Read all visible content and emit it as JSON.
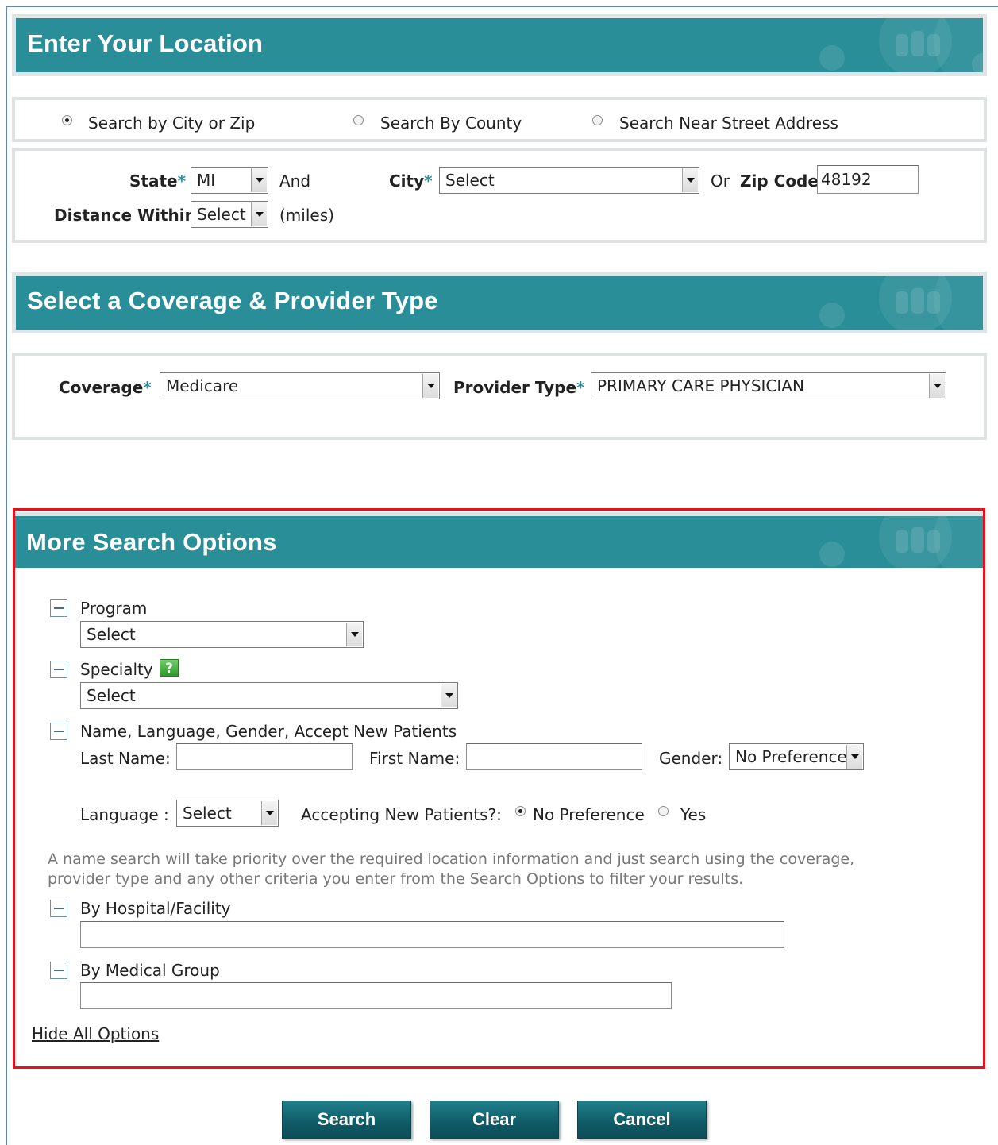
{
  "location": {
    "title": "Enter Your Location",
    "search_modes": [
      {
        "label": "Search by City or Zip",
        "selected": true
      },
      {
        "label": "Search By County",
        "selected": false
      },
      {
        "label": "Search Near Street Address",
        "selected": false
      }
    ],
    "state_label": "State",
    "state_value": "MI",
    "and_label": "And",
    "city_label": "City",
    "city_value": "Select",
    "or_label": "Or",
    "zip_label": "Zip Code",
    "zip_value": "48192",
    "distance_label": "Distance Within",
    "distance_value": "Select",
    "miles_label": "(miles)",
    "required_mark": "*"
  },
  "coverage": {
    "title": "Select a Coverage & Provider Type",
    "coverage_label": "Coverage",
    "coverage_value": "Medicare",
    "provider_label": "Provider Type",
    "provider_value": "PRIMARY CARE PHYSICIAN"
  },
  "more": {
    "title": "More Search Options",
    "program_label": "Program",
    "program_value": "Select",
    "specialty_label": "Specialty",
    "specialty_value": "Select",
    "help_glyph": "?",
    "name_section_label": "Name, Language, Gender, Accept New Patients",
    "last_name_label": "Last Name:",
    "first_name_label": "First Name:",
    "gender_label": "Gender:",
    "gender_value": "No Preference",
    "language_label": "Language :",
    "language_value": "Select",
    "accepting_label": "Accepting New Patients?:",
    "accepting_options": [
      {
        "label": "No Preference",
        "selected": true
      },
      {
        "label": "Yes",
        "selected": false
      }
    ],
    "note": "A name search will take priority over the required location information and just search using the coverage, provider type and any other criteria you enter from the Search Options to filter your results.",
    "hospital_label": "By Hospital/Facility",
    "medical_group_label": "By Medical Group",
    "hide_all_label": "Hide All Options"
  },
  "buttons": {
    "search": "Search",
    "clear": "Clear",
    "cancel": "Cancel"
  },
  "colors": {
    "header_teal": "#2a8e98",
    "highlight_red": "#e0141a",
    "button_dark_teal": "#0f5a66"
  }
}
